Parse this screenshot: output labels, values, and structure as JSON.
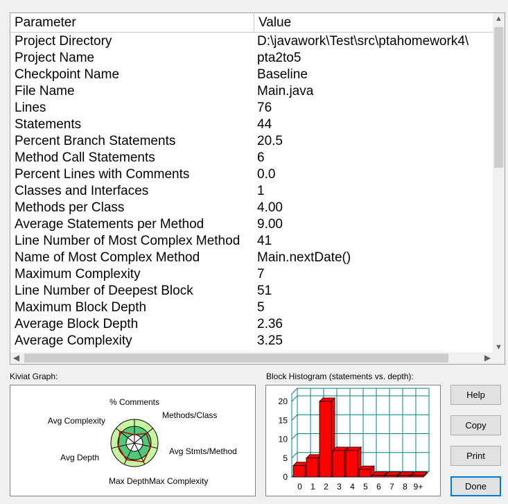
{
  "table": {
    "headers": {
      "parameter": "Parameter",
      "value": "Value"
    },
    "rows": [
      {
        "param": "Project Directory",
        "value": "D:\\javawork\\Test\\src\\ptahomework4\\"
      },
      {
        "param": "Project Name",
        "value": "pta2to5"
      },
      {
        "param": "Checkpoint Name",
        "value": "Baseline"
      },
      {
        "param": "File Name",
        "value": "Main.java"
      },
      {
        "param": "Lines",
        "value": "76"
      },
      {
        "param": "Statements",
        "value": "44"
      },
      {
        "param": "Percent Branch Statements",
        "value": "20.5"
      },
      {
        "param": "Method Call Statements",
        "value": "6"
      },
      {
        "param": "Percent Lines with Comments",
        "value": "0.0"
      },
      {
        "param": "Classes and Interfaces",
        "value": "1"
      },
      {
        "param": "Methods per Class",
        "value": "4.00"
      },
      {
        "param": "Average Statements per Method",
        "value": "9.00"
      },
      {
        "param": "Line Number of Most Complex Method",
        "value": "41"
      },
      {
        "param": "Name of Most Complex Method",
        "value": "Main.nextDate()"
      },
      {
        "param": "Maximum Complexity",
        "value": "7"
      },
      {
        "param": "Line Number of Deepest Block",
        "value": "51"
      },
      {
        "param": "Maximum Block Depth",
        "value": "5"
      },
      {
        "param": "Average Block Depth",
        "value": "2.36"
      },
      {
        "param": "Average Complexity",
        "value": "3.25"
      }
    ]
  },
  "scroll_icons": {
    "up": "▲",
    "down": "▼",
    "left": "◀",
    "right": "▶"
  },
  "kiviat": {
    "label": "Kiviat Graph:",
    "axes": [
      "% Comments",
      "Methods/Class",
      "Avg Stmts/Method",
      "Max Complexity",
      "Max Depth",
      "Avg Depth",
      "Avg Complexity"
    ],
    "colors": {
      "outer_band": "#c8f5a0",
      "inner_zone": "#50c878",
      "plot_line": "#b00000"
    }
  },
  "histogram": {
    "label": "Block Histogram (statements vs. depth):",
    "bar_color": "#ff0000"
  },
  "chart_data": {
    "type": "bar",
    "title": "Block Histogram (statements vs. depth):",
    "categories": [
      "0",
      "1",
      "2",
      "3",
      "4",
      "5",
      "6",
      "7",
      "8",
      "9+"
    ],
    "values": [
      3,
      5,
      20,
      7,
      7,
      2,
      0,
      0,
      0,
      0
    ],
    "yticks": [
      "0",
      "5",
      "10",
      "15",
      "20"
    ],
    "ylim": [
      0,
      22
    ],
    "grid": true
  },
  "buttons": {
    "help": "Help",
    "copy": "Copy",
    "print": "Print",
    "done": "Done"
  }
}
